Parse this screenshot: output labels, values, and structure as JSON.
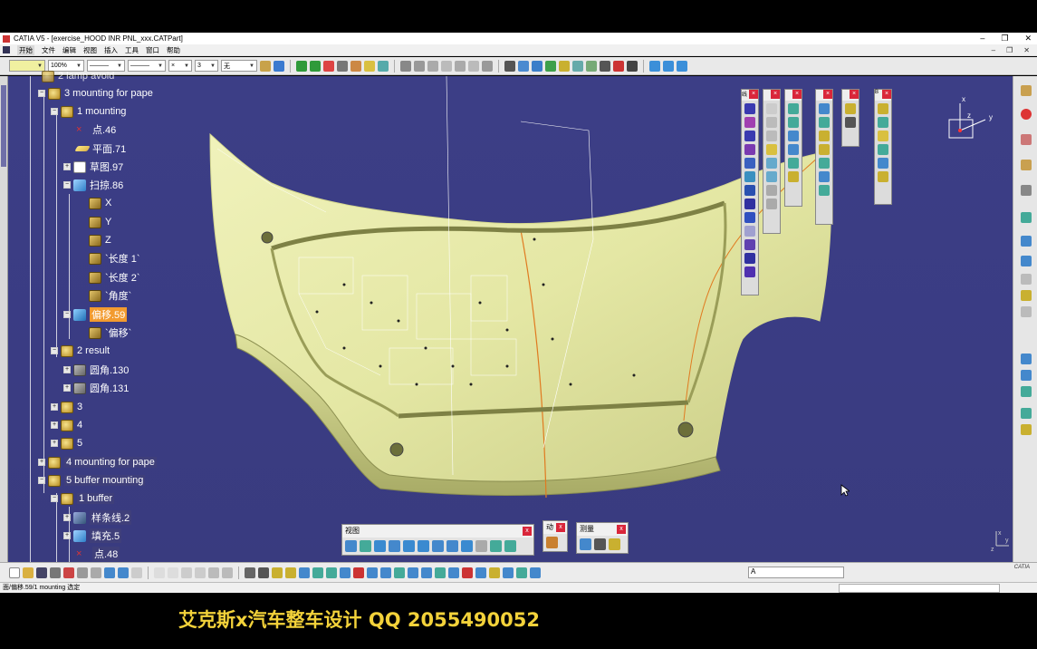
{
  "window": {
    "title": "CATIA V5 - [exercise_HOOD INR PNL_xxx.CATPart]",
    "controls": [
      "–",
      "❐",
      "✕"
    ]
  },
  "menubar": {
    "items": [
      "开始",
      "文件",
      "编辑",
      "视图",
      "插入",
      "工具",
      "窗口",
      "帮助"
    ],
    "mdi_controls": [
      "–",
      "❐",
      "✕"
    ]
  },
  "toolbar_top": {
    "color_combo": "",
    "transparency_combo": "100%",
    "point_combo": "×",
    "thickness_combo": "3",
    "layer_combo": "无"
  },
  "tree": {
    "partial_top": "2 lamp avoid",
    "nodes": [
      {
        "label": "3 mounting for pape",
        "icon": "gear"
      },
      {
        "label": "1 mounting",
        "icon": "gear"
      },
      {
        "label": "点.46",
        "icon": "point"
      },
      {
        "label": "平面.71",
        "icon": "plane"
      },
      {
        "label": "草图.97",
        "icon": "sketch"
      },
      {
        "label": "扫掠.86",
        "icon": "sweep"
      },
      {
        "label": "X",
        "icon": "feature"
      },
      {
        "label": "Y",
        "icon": "feature"
      },
      {
        "label": "Z",
        "icon": "feature"
      },
      {
        "label": "`长度 1`",
        "icon": "feature"
      },
      {
        "label": "`长度 2`",
        "icon": "feature"
      },
      {
        "label": "`角度`",
        "icon": "feature"
      },
      {
        "label": "偏移.59",
        "icon": "offset"
      },
      {
        "label": "`偏移`",
        "icon": "feature"
      },
      {
        "label": "2 result",
        "icon": "gear"
      },
      {
        "label": "圆角.130",
        "icon": "fillet"
      },
      {
        "label": "圆角.131",
        "icon": "fillet"
      },
      {
        "label": "3",
        "icon": "gear"
      },
      {
        "label": "4",
        "icon": "gear"
      },
      {
        "label": "5",
        "icon": "gear"
      },
      {
        "label": "4 mounting for pape",
        "icon": "gear"
      },
      {
        "label": "5 buffer mounting",
        "icon": "gear"
      },
      {
        "label": "1 buffer",
        "icon": "gear"
      },
      {
        "label": "样条线.2",
        "icon": "spline"
      },
      {
        "label": "填充.5",
        "icon": "sweep"
      },
      {
        "label": "点.48",
        "icon": "point"
      }
    ]
  },
  "compass": {
    "x_label": "x",
    "y_label": "y",
    "z_label": "z"
  },
  "floating_toolbars": {
    "view": {
      "title": "视图",
      "close": "x"
    },
    "animation": {
      "title": "动",
      "close": "x"
    },
    "measure": {
      "title": "测量",
      "close": "x"
    },
    "vertical_heads": [
      "线",
      "",
      "",
      "",
      "",
      "B"
    ]
  },
  "axis_indicator": {
    "x": "x",
    "y": "y",
    "z": "z"
  },
  "command_field": {
    "value": "A"
  },
  "brand": "CATIA",
  "status": {
    "text": "面/偏移.59/1 mounting 选定"
  },
  "watermark": "艾克斯x汽车整车设计 QQ 2055490052",
  "colors": {
    "viewport_bg": "#3b3d84",
    "part_surface": "#e6e9a9",
    "selection_orange": "#f29b2f",
    "close_red": "#d9263a",
    "watermark_yellow": "#f3d23a"
  }
}
